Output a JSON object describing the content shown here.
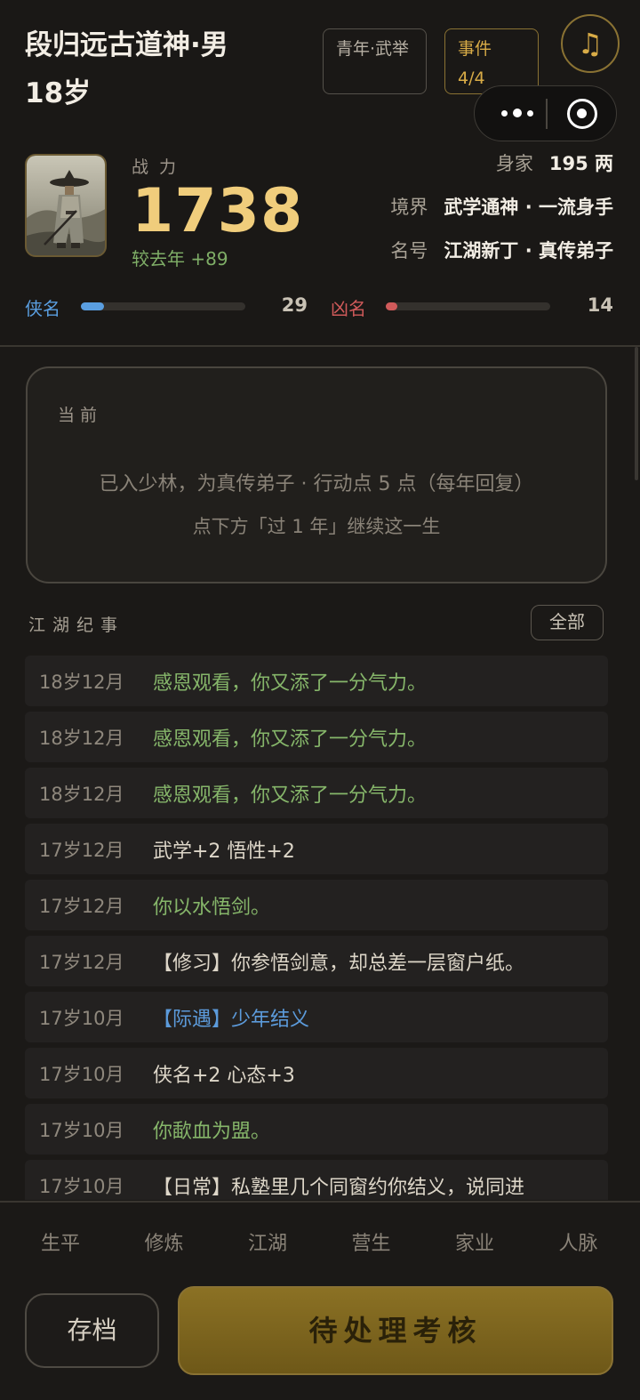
{
  "header": {
    "name": "段归远古道神·男",
    "age": "18岁",
    "tag_age": "青年·武举",
    "tag_event": "事件\n4/4",
    "music_icon": "music-note-icon",
    "power_label": "战力",
    "power_value": "1738",
    "power_delta": "较去年 +89",
    "wealth_label": "身家",
    "wealth_value": "195 两",
    "realm_label": "境界",
    "realm_value": "武学通神 · 一流身手",
    "title_label": "名号",
    "title_value": "江湖新丁 · 真传弟子",
    "xia_label": "侠名",
    "xia_value": "29",
    "xia_fraction": 0.14,
    "xia_color": "#5a9ee0",
    "xiong_label": "凶名",
    "xiong_value": "14",
    "xiong_fraction": 0.07,
    "xiong_color": "#d05a5a"
  },
  "current": {
    "title": "当前",
    "line1": "已入少林，为真传弟子 · 行动点 5 点（每年回复）",
    "line2": "点下方「过 1 年」继续这一生"
  },
  "log": {
    "title": "江湖纪事",
    "filter": "全部",
    "items": [
      {
        "time": "18岁12月",
        "text": "感恩观看，你又添了一分气力。",
        "color": "green"
      },
      {
        "time": "18岁12月",
        "text": "感恩观看，你又添了一分气力。",
        "color": "green"
      },
      {
        "time": "18岁12月",
        "text": "感恩观看，你又添了一分气力。",
        "color": "green"
      },
      {
        "time": "17岁12月",
        "text": "武学+2 悟性+2",
        "color": "white"
      },
      {
        "time": "17岁12月",
        "text": "你以水悟剑。",
        "color": "green"
      },
      {
        "time": "17岁12月",
        "text": "【修习】你参悟剑意，却总差一层窗户纸。",
        "color": "white"
      },
      {
        "time": "17岁10月",
        "text": "【际遇】少年结义",
        "color": "blue"
      },
      {
        "time": "17岁10月",
        "text": "侠名+2 心态+3",
        "color": "white"
      },
      {
        "time": "17岁10月",
        "text": "你歃血为盟。",
        "color": "green"
      },
      {
        "time": "17岁10月",
        "text": "【日常】私塾里几个同窗约你结义，说同进",
        "color": "white"
      }
    ]
  },
  "nav": {
    "tabs": [
      "生平",
      "修炼",
      "江湖",
      "营生",
      "家业",
      "人脉"
    ],
    "save": "存档",
    "main_action": "待处理考核"
  }
}
